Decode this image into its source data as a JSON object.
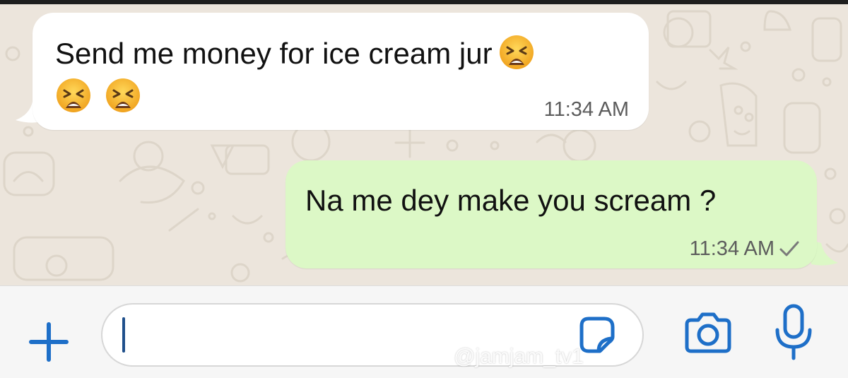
{
  "chat": {
    "incoming": {
      "text": "Send me money for ice cream jur",
      "emoji_icon": "weary-face-emoji",
      "time": "11:34 AM"
    },
    "outgoing": {
      "text": "Na me dey make you scream ?",
      "time": "11:34 AM",
      "status_icon": "single-check-icon"
    }
  },
  "composer": {
    "input_value": "",
    "icons": [
      "plus-icon",
      "sticker-icon",
      "camera-icon",
      "microphone-icon"
    ]
  },
  "watermark": {
    "text": "@jamjam_tv1",
    "icon": "tiktok-icon"
  },
  "colors": {
    "accent": "#1e6fc8",
    "incoming_bubble": "#ffffff",
    "outgoing_bubble": "#dcf8c6",
    "wallpaper": "#ece5dc"
  }
}
